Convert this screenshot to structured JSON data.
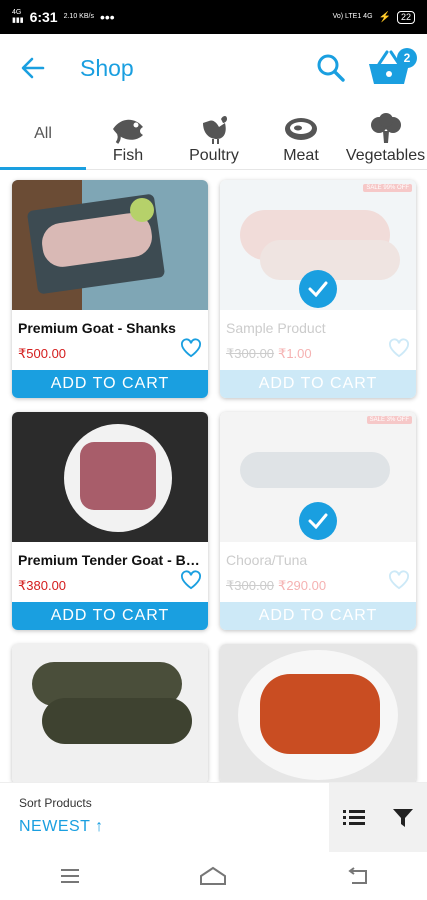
{
  "status_bar": {
    "time": "6:31",
    "speed": "2.10 KB/s",
    "network": "Vo) LTE1 4G",
    "battery": "22"
  },
  "header": {
    "title": "Shop",
    "cart_count": "2"
  },
  "categories": [
    {
      "label": "All"
    },
    {
      "label": "Fish"
    },
    {
      "label": "Poultry"
    },
    {
      "label": "Meat"
    },
    {
      "label": "Vegetables"
    }
  ],
  "products": [
    {
      "name": "Premium Goat - Shanks",
      "old_price": "",
      "price": "₹500.00",
      "button": "ADD TO CART",
      "disabled": false,
      "sale_tag": ""
    },
    {
      "name": "Sample Product",
      "old_price": "₹300.00",
      "price": "₹1.00",
      "button": "ADD TO CART",
      "disabled": true,
      "sale_tag": "SALE 99% OFF"
    },
    {
      "name": "Premium Tender Goat - Biry...",
      "old_price": "",
      "price": "₹380.00",
      "button": "ADD TO CART",
      "disabled": false,
      "sale_tag": ""
    },
    {
      "name": "Choora/Tuna",
      "old_price": "₹300.00",
      "price": "₹290.00",
      "button": "ADD TO CART",
      "disabled": true,
      "sale_tag": "SALE 3% OFF"
    }
  ],
  "sort": {
    "label": "Sort Products",
    "value": "NEWEST ↑"
  },
  "colors": {
    "accent": "#1a9fe0",
    "price": "#d41d1d"
  }
}
